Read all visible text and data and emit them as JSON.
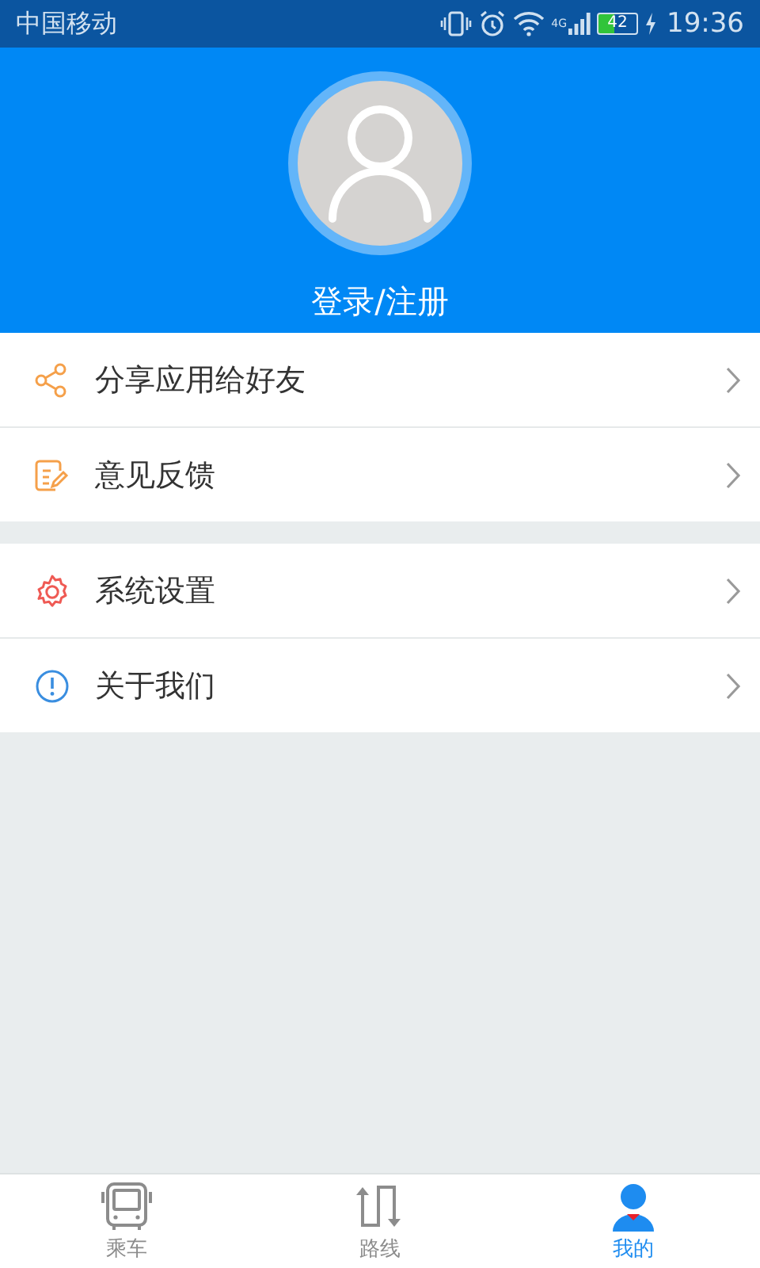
{
  "status_bar": {
    "carrier": "中国移动",
    "network": "4G",
    "battery": "42",
    "time": "19:36"
  },
  "profile": {
    "login_label": "登录/注册"
  },
  "menu_groups": [
    {
      "items": [
        {
          "kind": "share",
          "label": "分享应用给好友"
        },
        {
          "kind": "feedback",
          "label": "意见反馈"
        }
      ]
    },
    {
      "items": [
        {
          "kind": "settings",
          "label": "系统设置"
        },
        {
          "kind": "about",
          "label": "关于我们"
        }
      ]
    }
  ],
  "tabs": [
    {
      "kind": "bus",
      "label": "乘车",
      "selected": false
    },
    {
      "kind": "route",
      "label": "路线",
      "selected": false
    },
    {
      "kind": "me",
      "label": "我的",
      "selected": true
    }
  ]
}
